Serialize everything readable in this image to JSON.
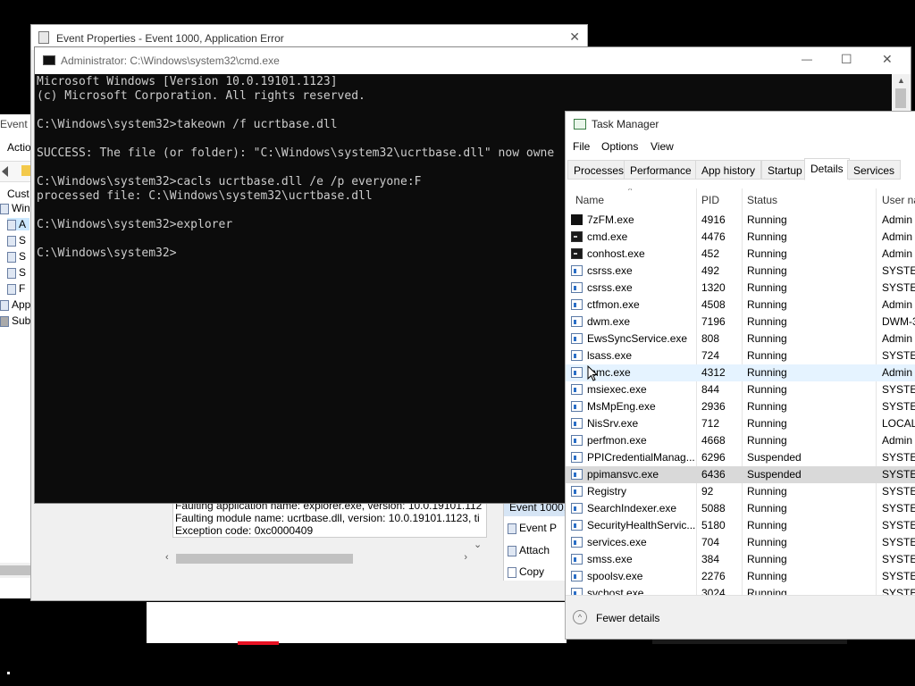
{
  "event_viewer_left": {
    "title": "Event Vi",
    "action_menu": "Actio",
    "tree": [
      {
        "label": "Cust"
      },
      {
        "label": "Wind"
      },
      {
        "label": "A"
      },
      {
        "label": "S"
      },
      {
        "label": "S"
      },
      {
        "label": "S"
      },
      {
        "label": "F"
      },
      {
        "label": "Appl"
      },
      {
        "label": "Subs"
      }
    ]
  },
  "event_properties": {
    "title": "Event Properties - Event 1000, Application Error",
    "description_lines": [
      "Faulting application name: explorer.exe, version: 10.0.19101.112",
      "Faulting module name: ucrtbase.dll, version: 10.0.19101.1123, ti",
      "Exception code: 0xc0000409"
    ],
    "actions_header": "Event 1000,",
    "actions": [
      "Event P",
      "Attach",
      "Copy"
    ]
  },
  "cmd": {
    "title": "Administrator: C:\\Windows\\system32\\cmd.exe",
    "lines": [
      "Microsoft Windows [Version 10.0.19101.1123]",
      "(c) Microsoft Corporation. All rights reserved.",
      "",
      "C:\\Windows\\system32>takeown /f ucrtbase.dll",
      "",
      "SUCCESS: The file (or folder): \"C:\\Windows\\system32\\ucrtbase.dll\" now owne",
      "",
      "C:\\Windows\\system32>cacls ucrtbase.dll /e /p everyone:F",
      "processed file: C:\\Windows\\system32\\ucrtbase.dll",
      "",
      "C:\\Windows\\system32>explorer",
      "",
      "C:\\Windows\\system32>"
    ],
    "minimize_glyph": "—",
    "maximize_glyph": "☐",
    "close_glyph": "✕"
  },
  "task_manager": {
    "title": "Task Manager",
    "menu": [
      "File",
      "Options",
      "View"
    ],
    "tabs": [
      "Processes",
      "Performance",
      "App history",
      "Startup",
      "Details",
      "Services"
    ],
    "active_tab": "Details",
    "columns": {
      "name": "Name",
      "pid": "PID",
      "status": "Status",
      "user": "User na"
    },
    "rows": [
      {
        "name": "7zFM.exe",
        "pid": "4916",
        "status": "Running",
        "user": "Admin",
        "icon": "dark"
      },
      {
        "name": "cmd.exe",
        "pid": "4476",
        "status": "Running",
        "user": "Admin",
        "icon": "console"
      },
      {
        "name": "conhost.exe",
        "pid": "452",
        "status": "Running",
        "user": "Admin",
        "icon": "console"
      },
      {
        "name": "csrss.exe",
        "pid": "492",
        "status": "Running",
        "user": "SYSTEM",
        "icon": "window"
      },
      {
        "name": "csrss.exe",
        "pid": "1320",
        "status": "Running",
        "user": "SYSTEM",
        "icon": "window"
      },
      {
        "name": "ctfmon.exe",
        "pid": "4508",
        "status": "Running",
        "user": "Admin",
        "icon": "window"
      },
      {
        "name": "dwm.exe",
        "pid": "7196",
        "status": "Running",
        "user": "DWM-3",
        "icon": "window"
      },
      {
        "name": "EwsSyncService.exe",
        "pid": "808",
        "status": "Running",
        "user": "Admin",
        "icon": "window"
      },
      {
        "name": "lsass.exe",
        "pid": "724",
        "status": "Running",
        "user": "SYSTEM",
        "icon": "window"
      },
      {
        "name": "mmc.exe",
        "pid": "4312",
        "status": "Running",
        "user": "Admin",
        "icon": "window"
      },
      {
        "name": "msiexec.exe",
        "pid": "844",
        "status": "Running",
        "user": "SYSTEM",
        "icon": "window"
      },
      {
        "name": "MsMpEng.exe",
        "pid": "2936",
        "status": "Running",
        "user": "SYSTEM",
        "icon": "window"
      },
      {
        "name": "NisSrv.exe",
        "pid": "712",
        "status": "Running",
        "user": "LOCAL",
        "icon": "window"
      },
      {
        "name": "perfmon.exe",
        "pid": "4668",
        "status": "Running",
        "user": "Admin",
        "icon": "window"
      },
      {
        "name": "PPICredentialManag...",
        "pid": "6296",
        "status": "Suspended",
        "user": "SYSTEM",
        "icon": "window"
      },
      {
        "name": "ppimansvc.exe",
        "pid": "6436",
        "status": "Suspended",
        "user": "SYSTEM",
        "icon": "window"
      },
      {
        "name": "Registry",
        "pid": "92",
        "status": "Running",
        "user": "SYSTEM",
        "icon": "window"
      },
      {
        "name": "SearchIndexer.exe",
        "pid": "5088",
        "status": "Running",
        "user": "SYSTEM",
        "icon": "window"
      },
      {
        "name": "SecurityHealthServic...",
        "pid": "5180",
        "status": "Running",
        "user": "SYSTEM",
        "icon": "window"
      },
      {
        "name": "services.exe",
        "pid": "704",
        "status": "Running",
        "user": "SYSTEM",
        "icon": "window"
      },
      {
        "name": "smss.exe",
        "pid": "384",
        "status": "Running",
        "user": "SYSTEM",
        "icon": "window"
      },
      {
        "name": "spoolsv.exe",
        "pid": "2276",
        "status": "Running",
        "user": "SYSTEM",
        "icon": "window"
      },
      {
        "name": "svchost.exe",
        "pid": "3024",
        "status": "Running",
        "user": "SYSTEM",
        "icon": "window"
      }
    ],
    "selected_row": "ppimansvc.exe",
    "hover_row": "mmc.exe",
    "fewer_details": "Fewer details"
  }
}
